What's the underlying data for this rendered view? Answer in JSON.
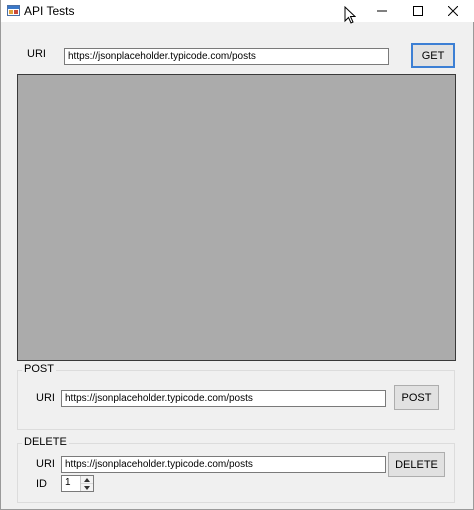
{
  "window": {
    "title": "API Tests",
    "controls": {
      "minimize": "minimize-icon",
      "maximize": "maximize-icon",
      "close": "close-icon"
    }
  },
  "get_section": {
    "uri_label": "URI",
    "uri_value": "https://jsonplaceholder.typicode.com/posts",
    "button_label": "GET"
  },
  "response": {
    "text": ""
  },
  "post_section": {
    "title": "POST",
    "uri_label": "URI",
    "uri_value": "https://jsonplaceholder.typicode.com/posts",
    "button_label": "POST"
  },
  "delete_section": {
    "title": "DELETE",
    "uri_label": "URI",
    "uri_value": "https://jsonplaceholder.typicode.com/posts",
    "button_label": "DELETE",
    "id_label": "ID",
    "id_value": "1"
  },
  "colors": {
    "window_bg": "#f0f0f0",
    "response_bg": "#ababab",
    "default_button_border": "#3c7fd4"
  }
}
